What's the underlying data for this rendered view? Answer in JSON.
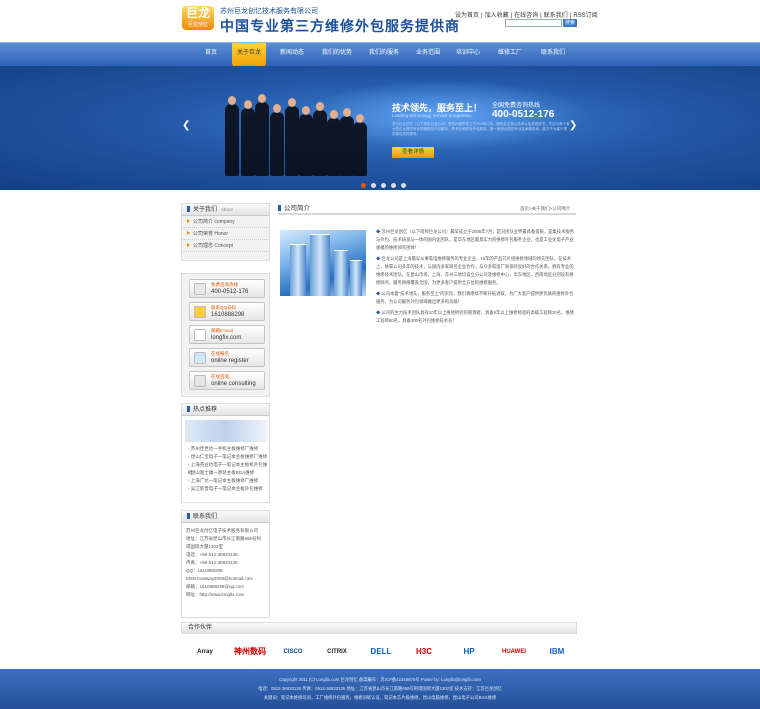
{
  "header": {
    "logo_text": "巨龙",
    "logo_sub": "巨龙创亿",
    "company": "苏州巨龙创亿技术服务有限公司",
    "slogan": "中国专业第三方维修外包服务提供商",
    "links": [
      "设为首页",
      "加入收藏",
      "在线咨询",
      "联系我们",
      "RSS订阅"
    ],
    "search_button": "搜索"
  },
  "nav": {
    "items": [
      "首页",
      "关于巨龙",
      "新闻动态",
      "我们的优势",
      "我们的服务",
      "业务范围",
      "培训中心",
      "维修工厂",
      "联系我们"
    ],
    "active_index": 1
  },
  "banner": {
    "headline": "技术领先，服务至上！",
    "headline_en": "Leading technology, service is supreme.",
    "hotline_label": "全国免费咨询热线",
    "hotline": "400-0512-176",
    "desc": "苏州巨龙创亿（以下简称巨龙公司）是苏州最早成立于2005年7月，拥有自主核心技术以及资质证书，先后为数十家大型企业提供专业的维修及外包服务，是专业维修及外包服务，是一家综合型的专业技术服务商，致力于为客户提供最优质的服务。",
    "button": "查看详情",
    "slide_count": 5,
    "active_slide": 0
  },
  "about": {
    "title": "关于我们",
    "title_en": "About",
    "items": [
      "公司简介 company",
      "公司荣誉 Honor",
      "公司理念 Concept"
    ]
  },
  "contact_buttons": [
    {
      "l1": "免费咨询热线",
      "l2": "400-0512-176",
      "icon": "phone-icon",
      "color": "#e8e8e8"
    },
    {
      "l1": "联系QQ号码",
      "l2": "1610888298",
      "icon": "qq-icon",
      "color": "#ffcf3a"
    },
    {
      "l1": "邮箱E-mail",
      "l2": "longfix.com",
      "icon": "mail-icon",
      "color": "#ffffff"
    },
    {
      "l1": "在线报名",
      "l2": "online register",
      "icon": "register-icon",
      "color": "#cfe7ff"
    },
    {
      "l1": "在线咨询",
      "l2": "online consulting",
      "icon": "consult-icon",
      "color": "#e6e6e6"
    }
  ],
  "hot": {
    "title": "热点推荐",
    "items": [
      "苏州佳世达一手机主板维修厂维修",
      "昆山仁宝电子一笔记本主板维修厂维修",
      "上海英业达电子一笔记本主板机外包维修",
      "昆山富士康一原装主板BGA维修",
      "上海广达一笔记本主板维修厂维修",
      "吴江新普电子一笔记本主板外包维修"
    ]
  },
  "contact": {
    "title": "联系我们",
    "lines": [
      "苏州巨龙创亿电子技术服务有限公司",
      "地址：江苏省昆山市长江南路668号利",
      "得国际大厦1302室",
      "电话：+86-512-36833136",
      "传真：+86-512-36833135",
      "QQ：1610888298",
      "MSN:trustway2008@hotmail.com",
      "邮箱：1610888298@qq.com",
      "网址：http://www.longfix.com"
    ]
  },
  "content": {
    "title": "公司简介",
    "breadcrumb": "首页>关于我们>公司简介",
    "paragraphs": [
      "苏州巨龙创亿（以下简称巨龙公司）最早成立于2005年7月，是对团队业界最具备资质，是集技术服务与外包、技术研发与一体的国内化团队，是华东地区最具实力的维修外包服务企业，也是工业化电子产业规模的维修领军团体！",
      "巨龙公司是上海最早从事笔电维修服务的专业企业，15年的产品芯片组维修领域的领先团队，在技术上，依靠公司多年的技术，与国内多家知名企业合作，与众多笔电厂商保持良好的合作关系，拥有专业的维修技术团队，在昆山市场，上海、苏州三地均设立分公司及维修中心，华东地区、西南地区分别设有维修网点，服务网络覆盖全国，为更多客户提供全方位的维修服务。",
      "公司本着“技术领先，服务至上”的宗旨，我们将继续不断开拓进取，为广大客户提供更优质的维修外包服务，为公司服务外包领域做出更多的贡献！",
      "公司的主力技术团队具有10年以上维修经验的管理者，具备5年以上维修经验的高级工程师30名，维修工程师80名，具备300名外包维修技术员！"
    ]
  },
  "partners": {
    "title": "合作伙伴",
    "logos": [
      {
        "name": "Array",
        "color": "#1a1a1a"
      },
      {
        "name": "神州数码",
        "color": "#d00000"
      },
      {
        "name": "CISCO",
        "color": "#0a3f8a"
      },
      {
        "name": "CITRIX",
        "color": "#222"
      },
      {
        "name": "DELL",
        "color": "#0a5fb5"
      },
      {
        "name": "H3C",
        "color": "#d00000"
      },
      {
        "name": "HP",
        "color": "#0a5fb5"
      },
      {
        "name": "HUAWEI",
        "color": "#d00000"
      },
      {
        "name": "IBM",
        "color": "#1f5fbf"
      }
    ]
  },
  "footer": {
    "line1": "Copyright 2011 (C) Longfix.com 巨龙创亿 备案编号：苏ICP备12345678号 Power by: Longfix@longfix.com",
    "line2": "电话：0512-36833136 传真：0512-36833135 地址：江苏省昆山市长江南路668号利得国际大厦1302室 技术支持：江苏巨龙创亿",
    "line3": "关键词：笔记本维修培训，工厂维修外包服务，维修训练认证，笔记本芯片级维修，昆山电脑维修，昆山电子公司BGA维修"
  }
}
